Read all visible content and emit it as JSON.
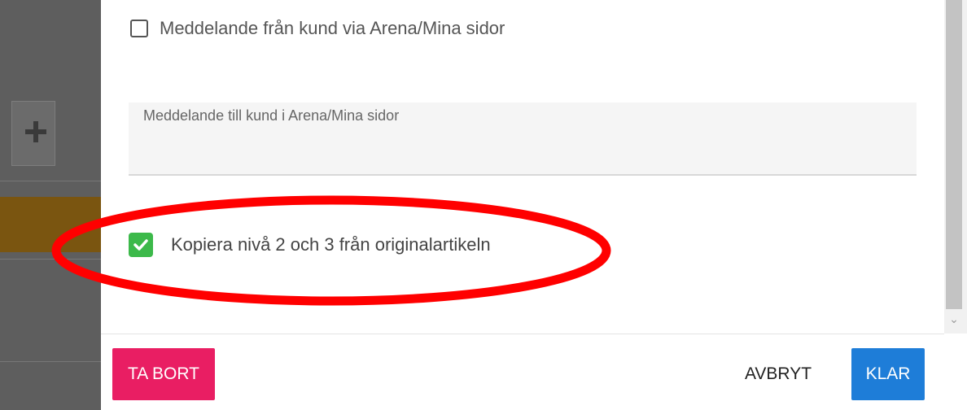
{
  "dialog": {
    "checkbox_customer_message": {
      "label": "Meddelande från kund via Arena/Mina sidor",
      "checked": false
    },
    "message_field": {
      "placeholder": "Meddelande till kund i Arena/Mina sidor",
      "value": ""
    },
    "checkbox_copy_levels": {
      "label": "Kopiera nivå 2 och 3 från originalartikeln",
      "checked": true
    },
    "highlight_color": "#ff0000"
  },
  "footer": {
    "delete_label": "TA BORT",
    "cancel_label": "AVBRYT",
    "done_label": "KLAR"
  },
  "colors": {
    "delete": "#e91e63",
    "done": "#1e7dd8",
    "checked": "#3cb94a"
  }
}
